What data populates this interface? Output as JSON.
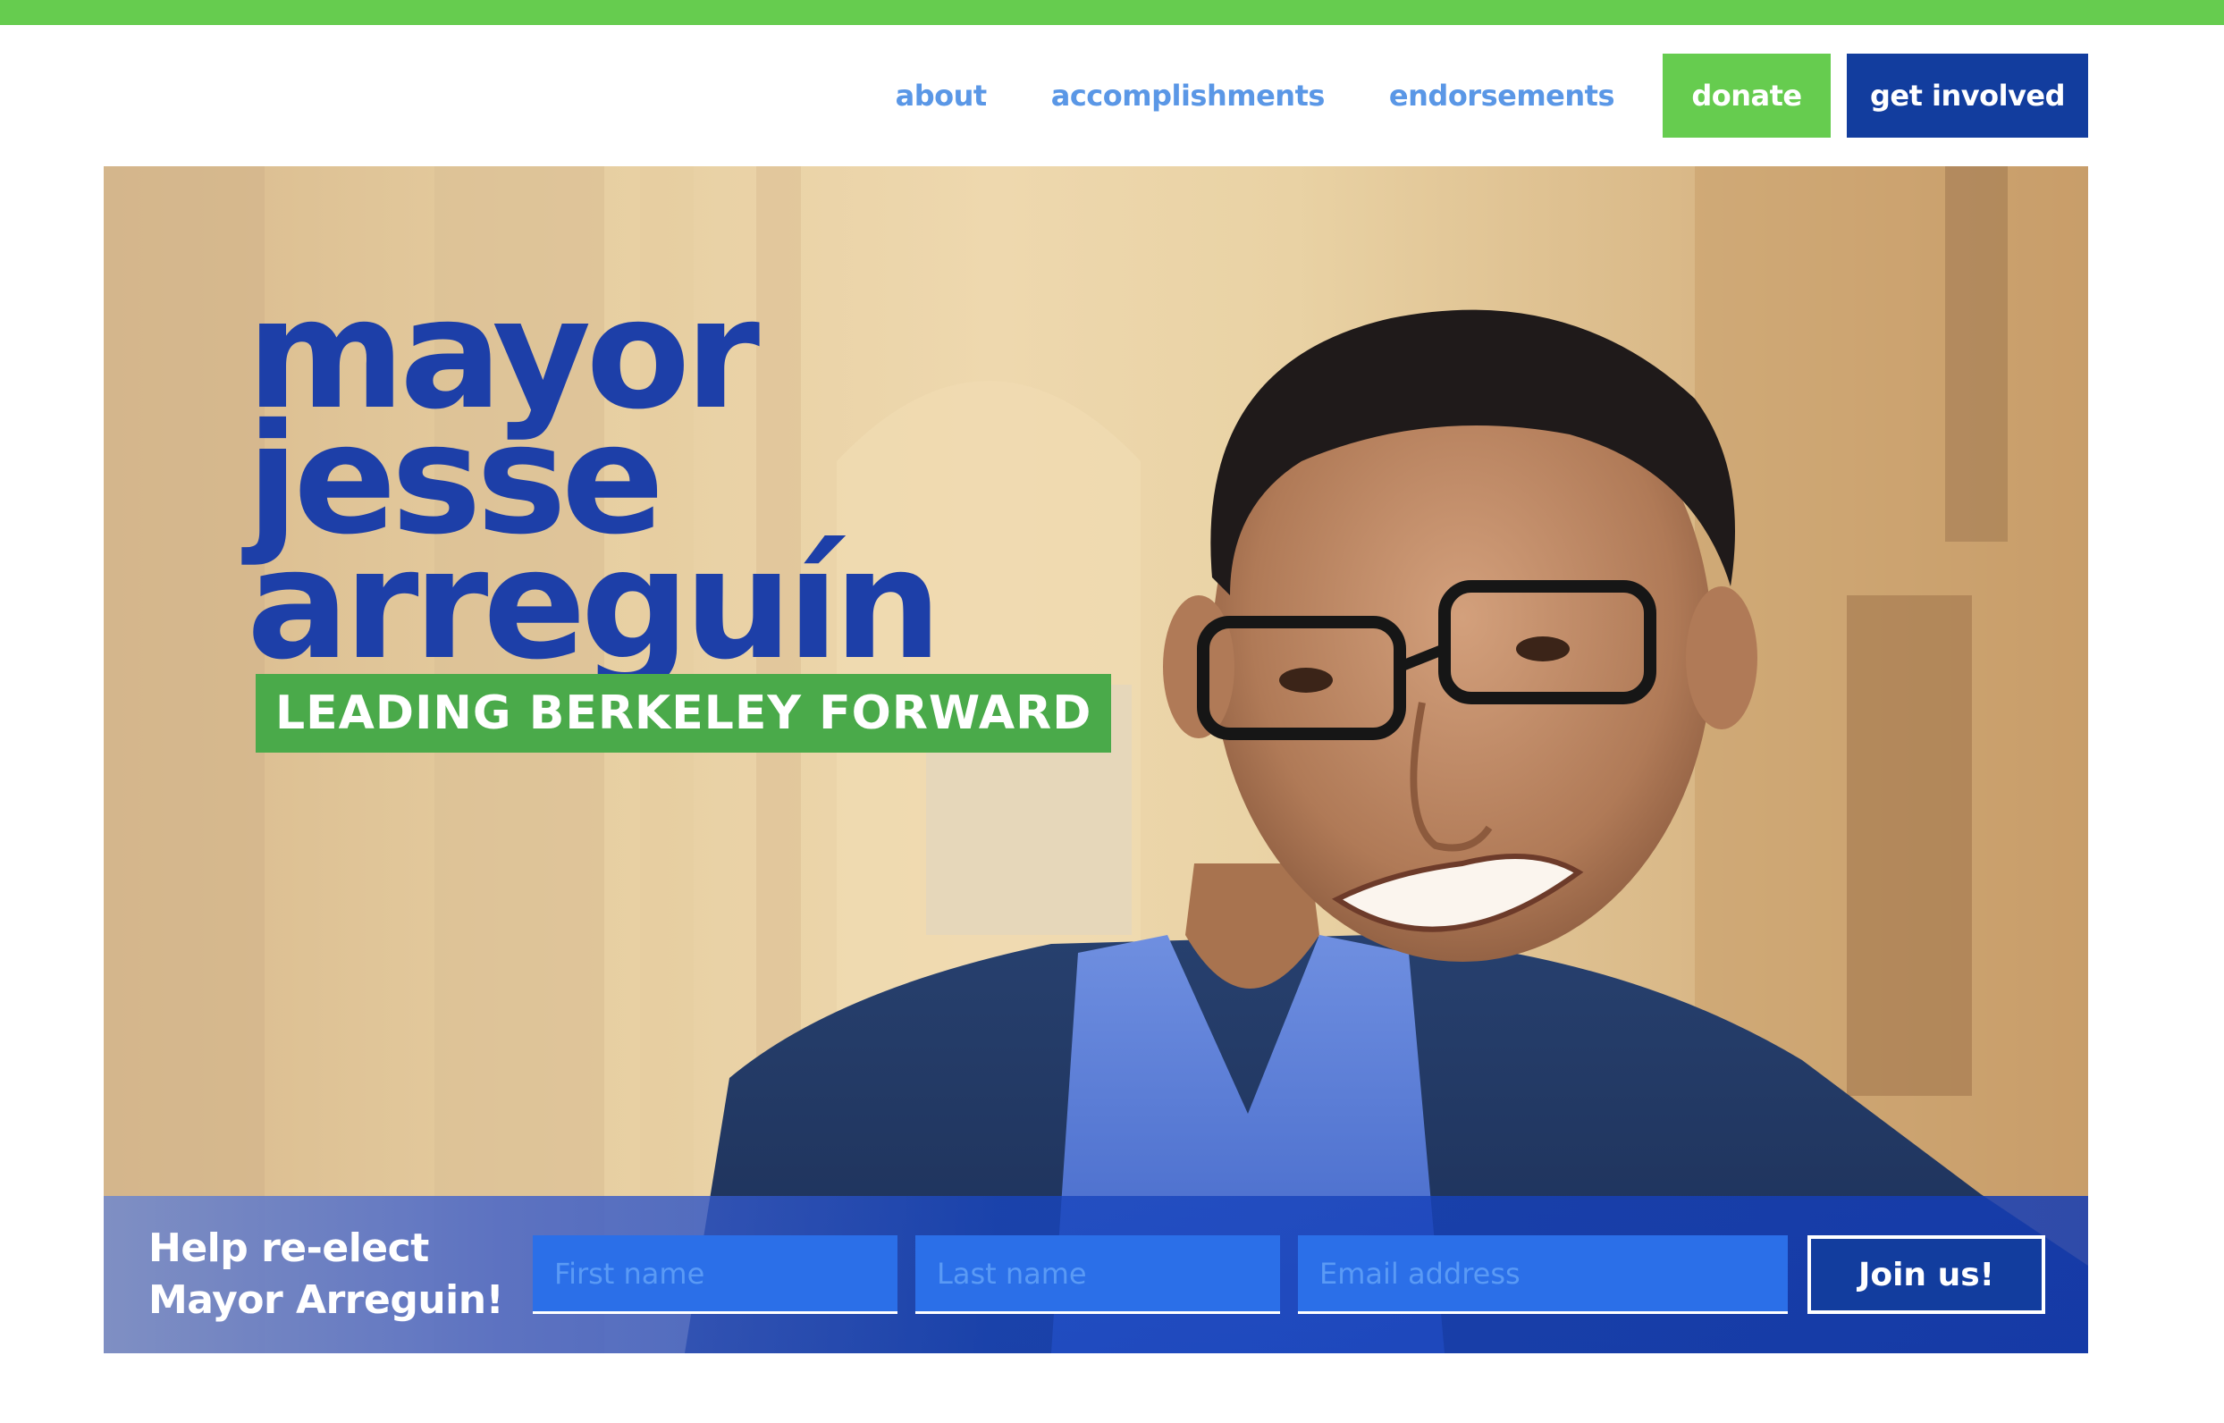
{
  "nav": {
    "about": "about",
    "accomplishments": "accomplishments",
    "endorsements": "endorsements",
    "donate": "donate",
    "get_involved": "get involved"
  },
  "hero": {
    "headline_line1": "mayor",
    "headline_line2": "jesse",
    "headline_line3": "arreguín",
    "tagline": "LEADING BERKELEY FORWARD",
    "photo": "portrait-photo"
  },
  "signup": {
    "title": "Help re-elect Mayor Arreguin!",
    "first_name_placeholder": "First name",
    "last_name_placeholder": "Last name",
    "email_placeholder": "Email address",
    "submit_label": "Join us!"
  },
  "colors": {
    "accent_green": "#66cc4f",
    "brand_blue": "#123d9e",
    "link_blue": "#5a97e6",
    "headline_blue": "#1d3fa8",
    "tagline_green": "#4aaa4a"
  }
}
